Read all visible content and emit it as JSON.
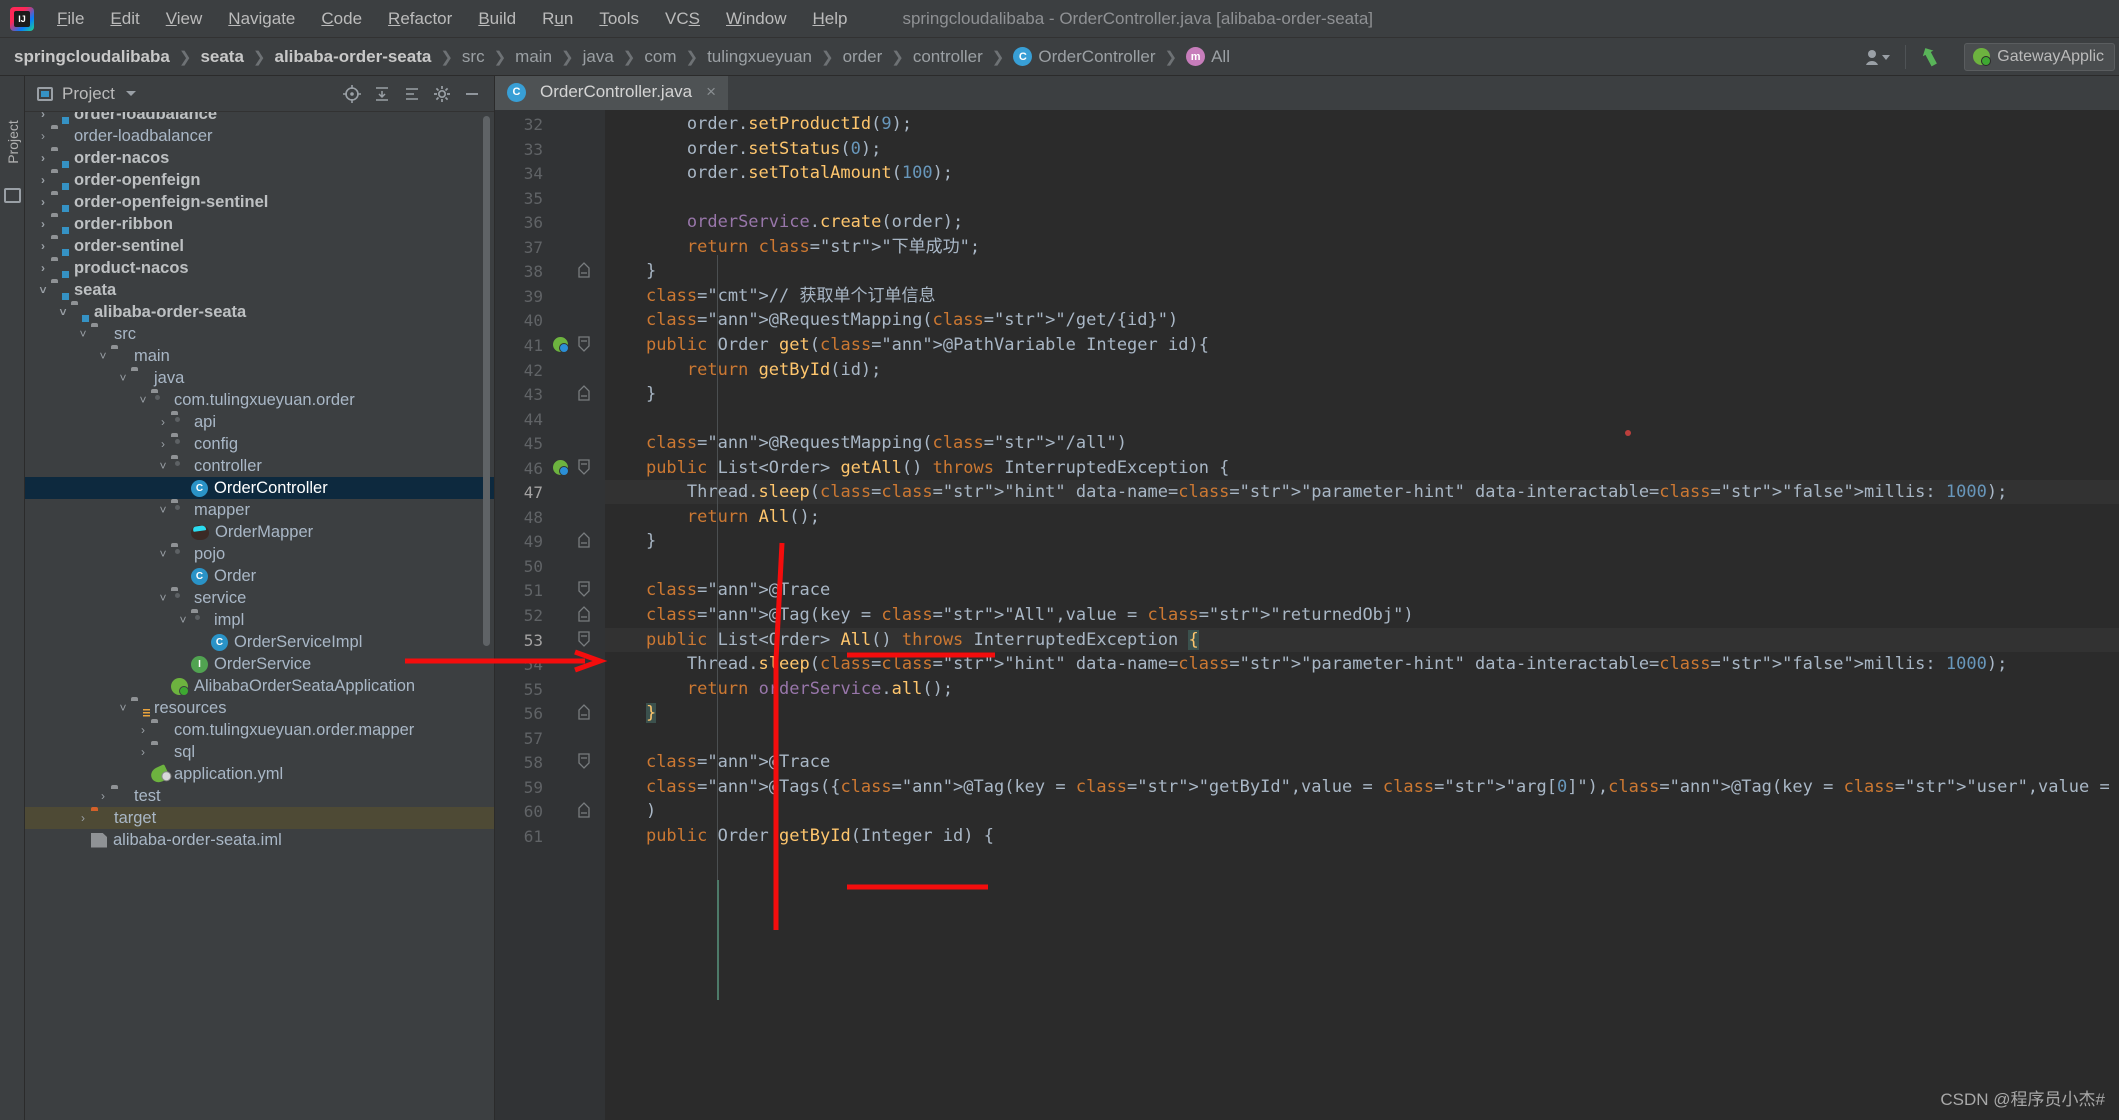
{
  "window": {
    "title": "springcloudalibaba - OrderController.java [alibaba-order-seata]"
  },
  "menubar": {
    "items": [
      {
        "label": "File",
        "mnemonic": "F"
      },
      {
        "label": "Edit",
        "mnemonic": "E"
      },
      {
        "label": "View",
        "mnemonic": "V"
      },
      {
        "label": "Navigate",
        "mnemonic": "N"
      },
      {
        "label": "Code",
        "mnemonic": "C"
      },
      {
        "label": "Refactor",
        "mnemonic": "R"
      },
      {
        "label": "Build",
        "mnemonic": "B"
      },
      {
        "label": "Run",
        "mnemonic": "u"
      },
      {
        "label": "Tools",
        "mnemonic": "T"
      },
      {
        "label": "VCS",
        "mnemonic": "S"
      },
      {
        "label": "Window",
        "mnemonic": "W"
      },
      {
        "label": "Help",
        "mnemonic": "H"
      }
    ]
  },
  "breadcrumb": {
    "items": [
      {
        "label": "springcloudalibaba",
        "style": "bold"
      },
      {
        "label": "seata",
        "style": "bold"
      },
      {
        "label": "alibaba-order-seata",
        "style": "bold"
      },
      {
        "label": "src",
        "style": "dim"
      },
      {
        "label": "main",
        "style": "dim"
      },
      {
        "label": "java",
        "style": "dim"
      },
      {
        "label": "com",
        "style": "dim"
      },
      {
        "label": "tulingxueyuan",
        "style": "dim"
      },
      {
        "label": "order",
        "style": "dim"
      },
      {
        "label": "controller",
        "style": "dim"
      },
      {
        "label": "OrderController",
        "style": "dim",
        "badge": "C"
      },
      {
        "label": "All",
        "style": "dim",
        "badge": "m"
      }
    ],
    "run_config": "GatewayApplic",
    "icons": [
      "user-settings-icon",
      "vcs-update-icon",
      "spring-boot-icon"
    ]
  },
  "tool_strip": {
    "label": "Project",
    "icon": "project-structure-icon"
  },
  "project_panel": {
    "title": "Project",
    "toolbar_icons": [
      "locate-icon",
      "collapse-all-icon",
      "expand-all-icon",
      "settings-gear-icon",
      "hide-icon"
    ],
    "tree": [
      {
        "label": "order-loadbalance",
        "depth": 1,
        "arrow": "right",
        "icon": "module-folder",
        "bold": true,
        "partial": true
      },
      {
        "label": "order-loadbalancer",
        "depth": 1,
        "arrow": "right",
        "icon": "folder",
        "bold": false
      },
      {
        "label": "order-nacos",
        "depth": 1,
        "arrow": "right",
        "icon": "module-folder",
        "bold": true
      },
      {
        "label": "order-openfeign",
        "depth": 1,
        "arrow": "right",
        "icon": "module-folder",
        "bold": true
      },
      {
        "label": "order-openfeign-sentinel",
        "depth": 1,
        "arrow": "right",
        "icon": "module-folder",
        "bold": true
      },
      {
        "label": "order-ribbon",
        "depth": 1,
        "arrow": "right",
        "icon": "module-folder",
        "bold": true
      },
      {
        "label": "order-sentinel",
        "depth": 1,
        "arrow": "right",
        "icon": "module-folder",
        "bold": true
      },
      {
        "label": "product-nacos",
        "depth": 1,
        "arrow": "right",
        "icon": "module-folder",
        "bold": true
      },
      {
        "label": "seata",
        "depth": 1,
        "arrow": "down",
        "icon": "module-folder",
        "bold": true
      },
      {
        "label": "alibaba-order-seata",
        "depth": 2,
        "arrow": "down",
        "icon": "module-folder",
        "bold": true
      },
      {
        "label": "src",
        "depth": 3,
        "arrow": "down",
        "icon": "folder"
      },
      {
        "label": "main",
        "depth": 4,
        "arrow": "down",
        "icon": "folder"
      },
      {
        "label": "java",
        "depth": 5,
        "arrow": "down",
        "icon": "source-folder"
      },
      {
        "label": "com.tulingxueyuan.order",
        "depth": 6,
        "arrow": "down",
        "icon": "package"
      },
      {
        "label": "api",
        "depth": 7,
        "arrow": "right",
        "icon": "package"
      },
      {
        "label": "config",
        "depth": 7,
        "arrow": "right",
        "icon": "package"
      },
      {
        "label": "controller",
        "depth": 7,
        "arrow": "down",
        "icon": "package"
      },
      {
        "label": "OrderController",
        "depth": 8,
        "arrow": "none",
        "icon": "class",
        "selected": true
      },
      {
        "label": "mapper",
        "depth": 7,
        "arrow": "down",
        "icon": "package"
      },
      {
        "label": "OrderMapper",
        "depth": 8,
        "arrow": "none",
        "icon": "mybatis"
      },
      {
        "label": "pojo",
        "depth": 7,
        "arrow": "down",
        "icon": "package"
      },
      {
        "label": "Order",
        "depth": 8,
        "arrow": "none",
        "icon": "class"
      },
      {
        "label": "service",
        "depth": 7,
        "arrow": "down",
        "icon": "package"
      },
      {
        "label": "impl",
        "depth": 8,
        "arrow": "down",
        "icon": "package"
      },
      {
        "label": "OrderServiceImpl",
        "depth": 9,
        "arrow": "none",
        "icon": "class"
      },
      {
        "label": "OrderService",
        "depth": 8,
        "arrow": "none",
        "icon": "interface"
      },
      {
        "label": "AlibabaOrderSeataApplication",
        "depth": 7,
        "arrow": "none",
        "icon": "spring-boot"
      },
      {
        "label": "resources",
        "depth": 5,
        "arrow": "down",
        "icon": "resource-folder"
      },
      {
        "label": "com.tulingxueyuan.order.mapper",
        "depth": 6,
        "arrow": "right",
        "icon": "folder"
      },
      {
        "label": "sql",
        "depth": 6,
        "arrow": "right",
        "icon": "folder"
      },
      {
        "label": "application.yml",
        "depth": 6,
        "arrow": "none",
        "icon": "yml"
      },
      {
        "label": "test",
        "depth": 4,
        "arrow": "right",
        "icon": "folder"
      },
      {
        "label": "target",
        "depth": 3,
        "arrow": "right",
        "icon": "target-folder",
        "highlighted": true
      },
      {
        "label": "alibaba-order-seata.iml",
        "depth": 3,
        "arrow": "none",
        "icon": "iml",
        "partial": true
      }
    ]
  },
  "editor": {
    "tab": {
      "label": "OrderController.java",
      "icon": "class",
      "close": "×"
    },
    "first_line_number": 32,
    "lines": [
      {
        "n": 32,
        "text": "        order.setProductId(9);"
      },
      {
        "n": 33,
        "text": "        order.setStatus(0);"
      },
      {
        "n": 34,
        "text": "        order.setTotalAmount(100);"
      },
      {
        "n": 35,
        "text": ""
      },
      {
        "n": 36,
        "text": "        orderService.create(order);"
      },
      {
        "n": 37,
        "text": "        return \"下单成功\";"
      },
      {
        "n": 38,
        "text": "    }",
        "fold": "end"
      },
      {
        "n": 39,
        "text": "    // 获取单个订单信息"
      },
      {
        "n": 40,
        "text": "    @RequestMapping(\"/get/{id}\")"
      },
      {
        "n": 41,
        "text": "    public Order get(@PathVariable Integer id){",
        "gutter_mark": "spring-request-mapping",
        "fold": "start"
      },
      {
        "n": 42,
        "text": "        return getById(id);"
      },
      {
        "n": 43,
        "text": "    }",
        "fold": "end"
      },
      {
        "n": 44,
        "text": ""
      },
      {
        "n": 45,
        "text": "    @RequestMapping(\"/all\")"
      },
      {
        "n": 46,
        "text": "    public List<Order> getAll() throws InterruptedException {",
        "gutter_mark": "spring-request-mapping",
        "fold": "start"
      },
      {
        "n": 47,
        "text": "        Thread.sleep( millis: 1000);"
      },
      {
        "n": 48,
        "text": "        return All();"
      },
      {
        "n": 49,
        "text": "    }",
        "fold": "end"
      },
      {
        "n": 50,
        "text": ""
      },
      {
        "n": 51,
        "text": "    @Trace",
        "fold": "start"
      },
      {
        "n": 52,
        "text": "    @Tag(key = \"All\",value = \"returnedObj\")",
        "fold": "end"
      },
      {
        "n": 53,
        "text": "    public List<Order> All() throws InterruptedException {",
        "fold": "start"
      },
      {
        "n": 54,
        "text": "        Thread.sleep( millis: 1000);"
      },
      {
        "n": 55,
        "text": "        return orderService.all();"
      },
      {
        "n": 56,
        "text": "    }",
        "fold": "end"
      },
      {
        "n": 57,
        "text": ""
      },
      {
        "n": 58,
        "text": "    @Trace",
        "fold": "start"
      },
      {
        "n": 59,
        "text": "    @Tags({@Tag(key = \"getById\",value = \"arg[0]\"),@Tag(key = \"user\",value = \"returnedObj\"),}"
      },
      {
        "n": 60,
        "text": "    )",
        "fold": "end"
      },
      {
        "n": 61,
        "text": "    public Order getById(Integer id) {"
      }
    ],
    "inlay_hints": [
      "millis:"
    ],
    "annotations": {
      "red_underlines": 2,
      "red_bracket": "connects project tree OrderController to code lines 44-56"
    }
  },
  "watermark": "CSDN @程序员小杰#",
  "colors": {
    "accent": "#3592c4",
    "selection": "#0d293e",
    "annotation_red": "#f40d0d",
    "editor_bg": "#2b2b2b",
    "panel_bg": "#3c3f41",
    "keyword": "#cc7832",
    "string": "#6a8759",
    "number": "#6897bb",
    "annotation_yellow": "#bbb529",
    "comment": "#808080",
    "field": "#9876aa",
    "method": "#ffc66d"
  }
}
